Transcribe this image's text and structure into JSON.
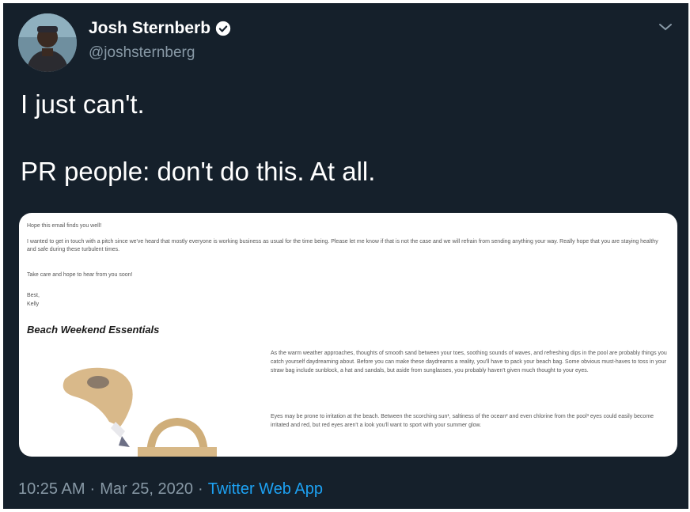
{
  "author": {
    "name": "Josh Sternberb",
    "handle": "@joshsternberg"
  },
  "tweet": {
    "line1": "I just can't.",
    "line2": "PR people: don't do this. At all."
  },
  "email_image": {
    "greeting": "Hope this email finds you well!",
    "intro": "I wanted to get in touch with a pitch since we've heard that mostly everyone is working business as usual for the time being. Please let me know if that is not the case and we will refrain from sending anything your way. Really hope that you are staying healthy and safe during these turbulent times.",
    "take_care": "Take care and hope to hear from you soon!",
    "signoff": "Best,",
    "signature": "Kelly",
    "heading": "Beach Weekend Essentials",
    "paragraph1": "As the warm weather approaches, thoughts of smooth sand between your toes, soothing sounds of waves, and refreshing dips in the pool are probably things you catch yourself daydreaming about. Before you can make these daydreams a reality, you'll have to pack your beach bag. Some obvious must-haves to toss in your straw bag include sunblock, a hat and sandals, but aside from sunglasses, you probably haven't given much thought to your eyes.",
    "paragraph2": "Eyes may be prone to irritation at the beach. Between the scorching sun¹, saltiness of the ocean² and even chlorine from the pool³ eyes could easily become irritated and red, but red eyes aren't a look you'll want to sport with your summer glow."
  },
  "footer": {
    "time": "10:25 AM",
    "dot1": "·",
    "date": "Mar 25, 2020",
    "dot2": "·",
    "source": "Twitter Web App"
  },
  "colors": {
    "background": "#15202b",
    "secondary_text": "#8899a6",
    "link": "#1da1f2"
  },
  "icons": [
    "verified-badge-icon",
    "chevron-down-icon"
  ]
}
